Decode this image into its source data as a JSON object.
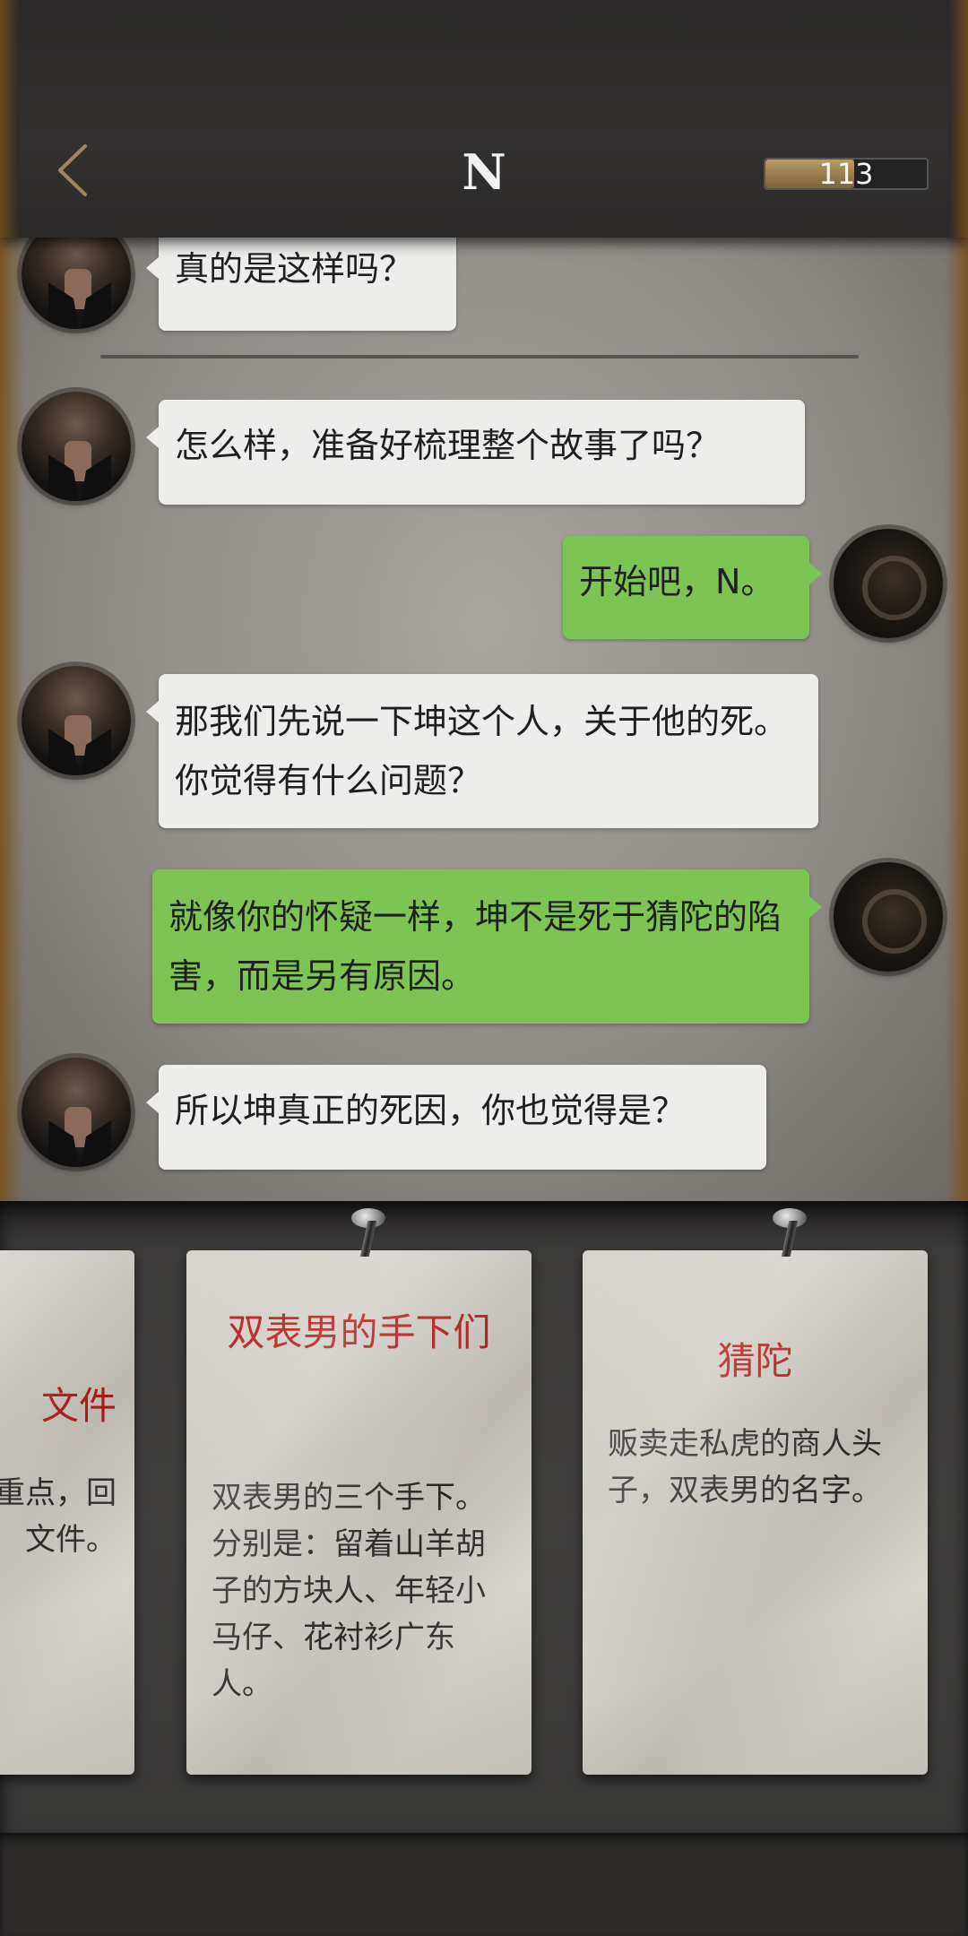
{
  "header": {
    "title": "N",
    "back_icon": "chevron-left-icon",
    "energy": {
      "value": "113",
      "fill_fraction": 0.55,
      "color": "#b89a66"
    }
  },
  "chat": {
    "messages": [
      {
        "from": "npc",
        "text": "真的是这样吗？"
      },
      {
        "from": "npc",
        "text": "怎么样，准备好梳理整个故事了吗？"
      },
      {
        "from": "me",
        "text": "开始吧，N。"
      },
      {
        "from": "npc",
        "text": "那我们先说一下坤这个人，关于他的死。你觉得有什么问题？"
      },
      {
        "from": "me",
        "text": "就像你的怀疑一样，坤不是死于猜陀的陷害，而是另有原因。"
      },
      {
        "from": "npc",
        "text": "所以坤真正的死因，你也觉得是？"
      }
    ],
    "npc_bubble_color": "#ededeb",
    "player_bubble_color": "#7ec455"
  },
  "clues": [
    {
      "title": "文件",
      "text": "重点，回文件。"
    },
    {
      "title": "双表男的手下们",
      "text": "双表男的三个手下。分别是：留着山羊胡子的方块人、年轻小马仔、花衬衫广东人。"
    },
    {
      "title": "猜陀",
      "text": "贩卖走私虎的商人头子，双表男的名字。"
    }
  ],
  "colors": {
    "clue_title": "#b21a16",
    "header_bg": "#333130"
  }
}
